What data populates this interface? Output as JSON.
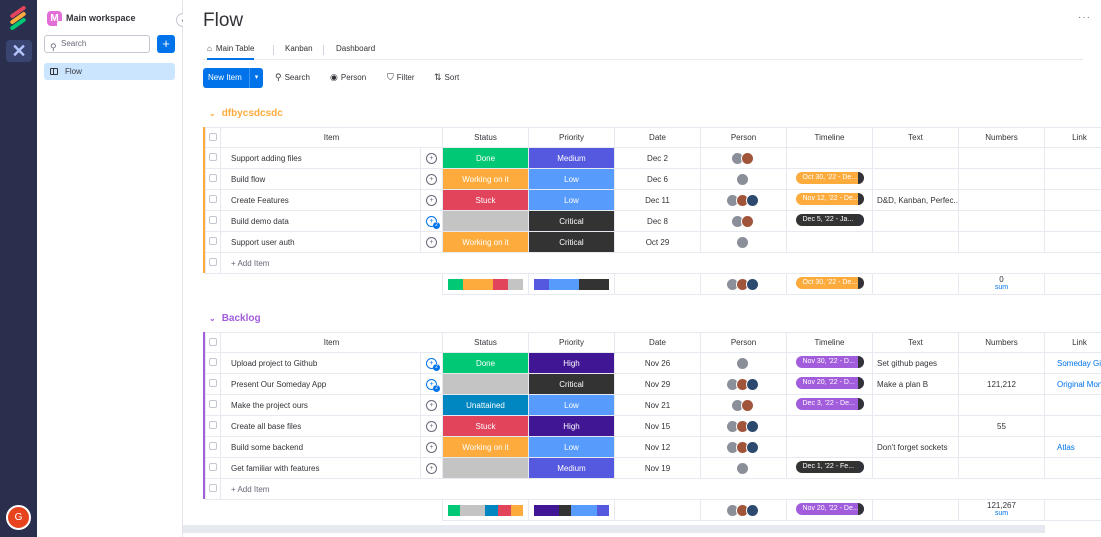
{
  "workspace": {
    "badge": "M",
    "name": "Main workspace"
  },
  "sidebar": {
    "search_placeholder": "Search",
    "plus": "+",
    "collapse": "‹",
    "items": [
      {
        "label": "Flow"
      }
    ]
  },
  "user": {
    "initial": "G"
  },
  "board": {
    "title": "Flow",
    "more": "···",
    "tabs": [
      {
        "label": "Main Table"
      },
      {
        "label": "Kanban"
      },
      {
        "label": "Dashboard"
      }
    ],
    "toolbar": {
      "new_item": "New Item",
      "search": "Search",
      "person": "Person",
      "filter": "Filter",
      "sort": "Sort"
    },
    "columns": [
      "Item",
      "Status",
      "Priority",
      "Date",
      "Person",
      "Timeline",
      "Text",
      "Numbers",
      "Link"
    ],
    "add_item": "+ Add Item"
  },
  "colors": {
    "done": "#00c875",
    "working": "#fdab3d",
    "stuck": "#e2445c",
    "unattained": "#0086c0",
    "empty": "#c4c4c4",
    "medium": "#5559df",
    "low": "#579bfc",
    "critical": "#333333",
    "high": "#401694",
    "group1": "#fdab3d",
    "group2": "#a25ddc"
  },
  "groups": [
    {
      "name": "dfbycsdcsdc",
      "rows": [
        {
          "item": "Support adding files",
          "conv": "",
          "status": "Done",
          "status_color": "#00c875",
          "priority": "Medium",
          "priority_color": "#5559df",
          "date": "Dec 2",
          "persons": 2,
          "timeline": "",
          "timeline_color": "",
          "text": "",
          "numbers": "",
          "link": ""
        },
        {
          "item": "Build flow",
          "conv": "",
          "status": "Working on it",
          "status_color": "#fdab3d",
          "priority": "Low",
          "priority_color": "#579bfc",
          "date": "Dec 6",
          "persons": 1,
          "timeline": "Oct 30, '22 - De...",
          "timeline_color": "#fdab3d",
          "text": "",
          "numbers": "",
          "link": ""
        },
        {
          "item": "Create Features",
          "conv": "",
          "status": "Stuck",
          "status_color": "#e2445c",
          "priority": "Low",
          "priority_color": "#579bfc",
          "date": "Dec 11",
          "persons": 3,
          "timeline": "Nov 12, '22 - De...",
          "timeline_color": "#fdab3d",
          "text": "D&D, Kanban, Perfec...",
          "numbers": "",
          "link": ""
        },
        {
          "item": "Build demo data",
          "conv": "2",
          "status": "",
          "status_color": "#c4c4c4",
          "priority": "Critical",
          "priority_color": "#333333",
          "date": "Dec 8",
          "persons": 2,
          "timeline": "Dec 5, '22 - Ja...",
          "timeline_color": "#333333",
          "text": "",
          "numbers": "",
          "link": ""
        },
        {
          "item": "Support user auth",
          "conv": "",
          "status": "Working on it",
          "status_color": "#fdab3d",
          "priority": "Critical",
          "priority_color": "#333333",
          "date": "Oct 29",
          "persons": 1,
          "timeline": "",
          "timeline_color": "",
          "text": "",
          "numbers": "",
          "link": ""
        }
      ],
      "summary": {
        "timeline": "Oct 30, '22 - De...",
        "timeline_color": "#fdab3d",
        "numbers": "0",
        "sum_label": "sum",
        "persons": 3
      }
    },
    {
      "name": "Backlog",
      "rows": [
        {
          "item": "Upload project to Github",
          "conv": "2",
          "status": "Done",
          "status_color": "#00c875",
          "priority": "High",
          "priority_color": "#401694",
          "date": "Nov 26",
          "persons": 1,
          "timeline": "Nov 30, '22 - D...",
          "timeline_color": "#a25ddc",
          "text": "Set github pages",
          "numbers": "",
          "link": "Someday Gith"
        },
        {
          "item": "Present Our Someday App",
          "conv": "2",
          "status": "",
          "status_color": "#c4c4c4",
          "priority": "Critical",
          "priority_color": "#333333",
          "date": "Nov 29",
          "persons": 3,
          "timeline": "Nov 20, '22 - D...",
          "timeline_color": "#a25ddc",
          "text": "Make a plan B",
          "numbers": "121,212",
          "link": "Original Mond"
        },
        {
          "item": "Make the project ours",
          "conv": "",
          "status": "Unattained",
          "status_color": "#0086c0",
          "priority": "Low",
          "priority_color": "#579bfc",
          "date": "Nov 21",
          "persons": 2,
          "timeline": "Dec 3, '22 - De...",
          "timeline_color": "#a25ddc",
          "text": "",
          "numbers": "",
          "link": ""
        },
        {
          "item": "Create all base files",
          "conv": "",
          "status": "Stuck",
          "status_color": "#e2445c",
          "priority": "High",
          "priority_color": "#401694",
          "date": "Nov 15",
          "persons": 3,
          "timeline": "",
          "timeline_color": "",
          "text": "",
          "numbers": "55",
          "link": ""
        },
        {
          "item": "Build some backend",
          "conv": "",
          "status": "Working on it",
          "status_color": "#fdab3d",
          "priority": "Low",
          "priority_color": "#579bfc",
          "date": "Nov 12",
          "persons": 3,
          "timeline": "",
          "timeline_color": "",
          "text": "Don't forget sockets",
          "numbers": "",
          "link": "Atlas"
        },
        {
          "item": "Get familiar with features",
          "conv": "",
          "status": "",
          "status_color": "#c4c4c4",
          "priority": "Medium",
          "priority_color": "#5559df",
          "date": "Nov 19",
          "persons": 1,
          "timeline": "Dec 1, '22 - Fe...",
          "timeline_color": "#333333",
          "text": "",
          "numbers": "",
          "link": ""
        }
      ],
      "summary": {
        "timeline": "Nov 20, '22 - De...",
        "timeline_color": "#a25ddc",
        "numbers": "121,267",
        "sum_label": "sum",
        "persons": 3
      }
    }
  ]
}
